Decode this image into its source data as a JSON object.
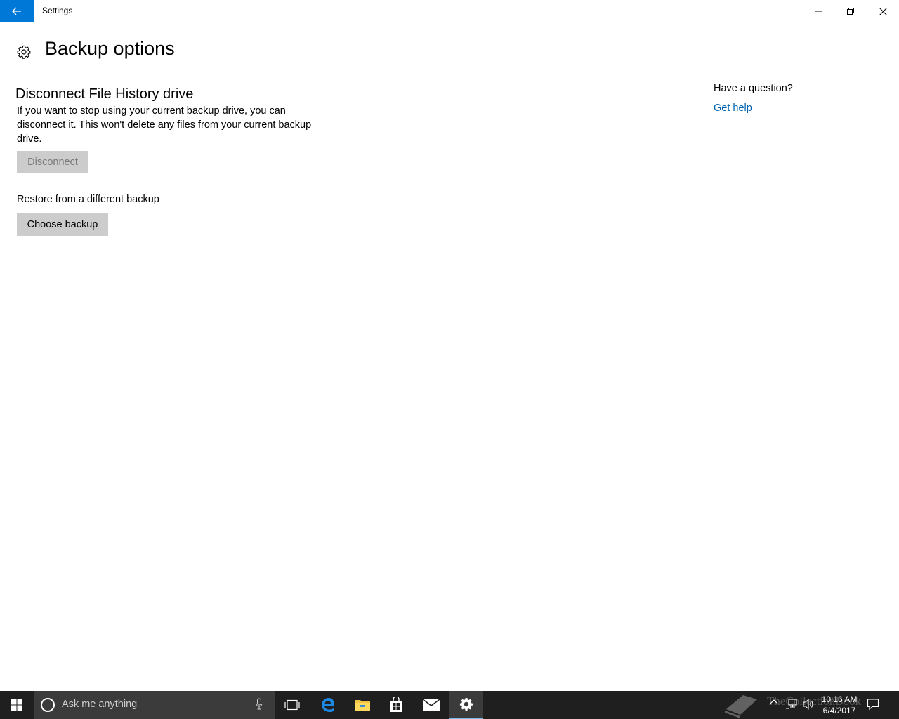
{
  "window": {
    "title": "Settings",
    "accent_color": "#0078d7"
  },
  "page": {
    "title": "Backup options",
    "icon": "gear-icon"
  },
  "disconnect_section": {
    "title": "Disconnect File History drive",
    "description": "If you want to stop using your current backup drive, you can disconnect it. This won't delete any files from your current backup drive.",
    "button_label": "Disconnect",
    "button_enabled": false
  },
  "restore_section": {
    "label": "Restore from a different backup",
    "button_label": "Choose backup"
  },
  "help": {
    "question": "Have a question?",
    "link_label": "Get help",
    "link_color": "#0063b1"
  },
  "taskbar": {
    "search_placeholder": "Ask me anything",
    "apps": [
      "task-view-icon",
      "edge-icon",
      "file-explorer-icon",
      "store-icon",
      "mail-icon",
      "settings-icon"
    ],
    "active_app": "settings-icon",
    "clock_time": "10:16 AM",
    "clock_date": "6/4/2017"
  },
  "watermark": {
    "text": "TheCollectionBook"
  }
}
